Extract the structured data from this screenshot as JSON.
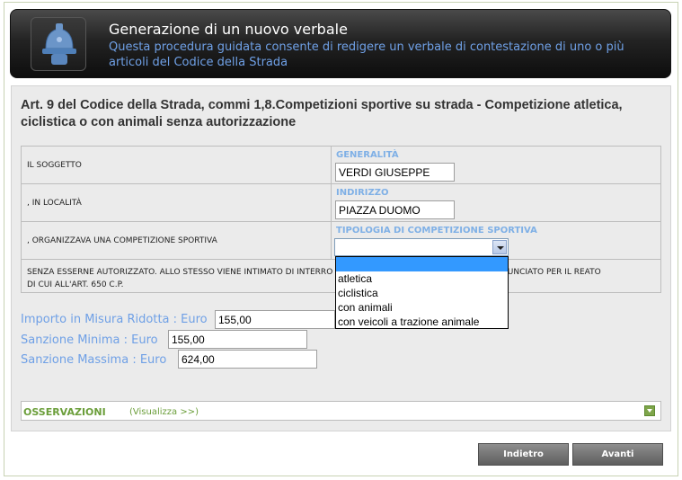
{
  "header": {
    "title": "Generazione di un nuovo verbale",
    "subtitle": "Questa procedura guidata consente di redigere un verbale di contestazione di uno o più articoli del Codice della Strada",
    "icon": "police-helmet-icon"
  },
  "article": {
    "title": "Art. 9 del Codice della Strada, commi 1,8.Competizioni sportive su strada - Competizione atletica, ciclistica o con animali senza autorizzazione"
  },
  "form": {
    "rows": [
      {
        "left_label": "IL SOGGETTO",
        "field_label": "GENERALITÀ",
        "value": "VERDI GIUSEPPE"
      },
      {
        "left_label": ", IN LOCALITÀ",
        "field_label": "INDIRIZZO",
        "value": "PIAZZA DUOMO"
      },
      {
        "left_label": ", ORGANIZZAVA UNA COMPETIZIONE SPORTIVA",
        "field_label": "TIPOLOGIA DI COMPETIZIONE SPORTIVA",
        "value": ""
      }
    ],
    "notice": "SENZA ESSERNE AUTORIZZATO. ALLO STESSO VIENE INTIMATO DI INTERRO",
    "notice_end": "RRÀ DENUNCIATO PER IL REATO",
    "notice_line2": "DI CUI ALL'ART. 650 C.P.",
    "dropdown_options": [
      "",
      "atletica",
      "ciclistica",
      "con animali",
      "con veicoli a trazione animale"
    ]
  },
  "amounts": {
    "ridotta_label": "Importo in Misura Ridotta : Euro",
    "ridotta_value": "155,00",
    "minima_label": "Sanzione Minima : Euro",
    "minima_value": "155,00",
    "massima_label": "Sanzione Massima : Euro",
    "massima_value": "624,00"
  },
  "observations": {
    "label": "OSSERVAZIONI",
    "link": "(Visualizza >>)"
  },
  "buttons": {
    "back": "Indietro",
    "next": "Avanti"
  },
  "colors": {
    "accent_blue": "#6fa0e6",
    "green": "#6b9e3a",
    "header_dark": "#1a1a1a"
  }
}
